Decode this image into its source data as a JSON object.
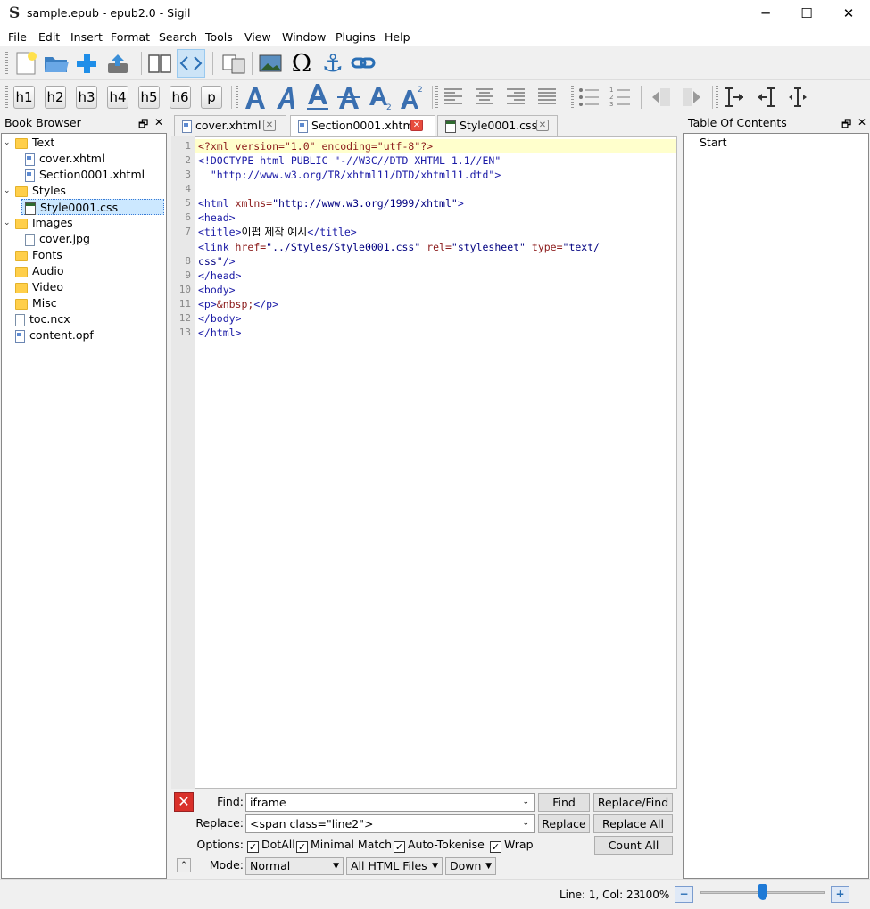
{
  "window": {
    "title": "sample.epub - epub2.0 - Sigil",
    "app_icon": "S",
    "minimize": "─",
    "maximize": "☐",
    "close": "✕"
  },
  "menu": [
    "File",
    "Edit",
    "Insert",
    "Format",
    "Search",
    "Tools",
    "View",
    "Window",
    "Plugins",
    "Help"
  ],
  "toolbar": {
    "headings": [
      "h1",
      "h2",
      "h3",
      "h4",
      "h5",
      "h6",
      "p"
    ],
    "omega": "Ω",
    "anchor": "⚓"
  },
  "book_browser": {
    "title": "Book Browser",
    "float": "🗗",
    "close": "✕",
    "items": [
      {
        "label": "Text",
        "type": "folder",
        "depth": 0,
        "expanded": true
      },
      {
        "label": "cover.xhtml",
        "type": "xhtml",
        "depth": 1
      },
      {
        "label": "Section0001.xhtml",
        "type": "xhtml",
        "depth": 1
      },
      {
        "label": "Styles",
        "type": "folder",
        "depth": 0,
        "expanded": true
      },
      {
        "label": "Style0001.css",
        "type": "css",
        "depth": 1,
        "selected": true
      },
      {
        "label": "Images",
        "type": "folder",
        "depth": 0,
        "expanded": true
      },
      {
        "label": "cover.jpg",
        "type": "file",
        "depth": 1
      },
      {
        "label": "Fonts",
        "type": "folder",
        "depth": 0
      },
      {
        "label": "Audio",
        "type": "folder",
        "depth": 0
      },
      {
        "label": "Video",
        "type": "folder",
        "depth": 0
      },
      {
        "label": "Misc",
        "type": "folder",
        "depth": 0
      },
      {
        "label": "toc.ncx",
        "type": "file",
        "depth": 0
      },
      {
        "label": "content.opf",
        "type": "xhtml",
        "depth": 0
      }
    ]
  },
  "tabs": [
    {
      "label": "cover.xhtml",
      "active": false
    },
    {
      "label": "Section0001.xhtml",
      "active": true
    },
    {
      "label": "Style0001.css",
      "active": false
    }
  ],
  "code_lines": [
    "1",
    "2",
    "3",
    "4",
    "5",
    "6",
    "7",
    "",
    "8",
    "9",
    "10",
    "11",
    "12",
    "13"
  ],
  "code": {
    "l1a": "<?xml version=\"1.0\" encoding=\"utf-8\"?>",
    "l2": "<!DOCTYPE html PUBLIC \"-//W3C//DTD XHTML 1.1//EN\"",
    "l3": "  \"http://www.w3.org/TR/xhtml11/DTD/xhtml11.dtd\">",
    "l5a": "<html ",
    "l5b": "xmlns=",
    "l5c": "\"http://www.w3.org/1999/xhtml\"",
    "l5d": ">",
    "l6": "<head>",
    "l7a": "<title>",
    "l7b": "이펍 제작 예시",
    "l7c": "</title>",
    "l8a": "<link ",
    "l8b": "href=",
    "l8c": "\"../Styles/Style0001.css\"",
    "l8d": " rel=",
    "l8e": "\"stylesheet\"",
    "l8f": " type=",
    "l8g": "\"text/",
    "l8h": "css\"",
    "l8i": "/>",
    "l9": "</head>",
    "l10": "<body>",
    "l11a": "<p>",
    "l11b": "&nbsp;",
    "l11c": "</p>",
    "l12": "</body>",
    "l13": "</html>"
  },
  "find_replace": {
    "find_label": "Find:",
    "find_value": "iframe",
    "replace_label": "Replace:",
    "replace_value": "<span class=\"line2\">",
    "options_label": "Options:",
    "mode_label": "Mode:",
    "buttons": {
      "find": "Find",
      "replace_find": "Replace/Find",
      "replace": "Replace",
      "replace_all": "Replace All",
      "count_all": "Count All"
    },
    "options": [
      {
        "label": "DotAll",
        "checked": true
      },
      {
        "label": "Minimal Match",
        "checked": true
      },
      {
        "label": "Auto-Tokenise",
        "checked": true
      },
      {
        "label": "Wrap",
        "checked": true
      }
    ],
    "mode": "Normal",
    "scope": "All HTML Files",
    "direction": "Down"
  },
  "toc": {
    "title": "Table Of Contents",
    "float": "🗗",
    "close": "✕",
    "items": [
      "Start"
    ]
  },
  "status": {
    "position": "Line: 1, Col: 23",
    "zoom": "100%",
    "zoom_fraction": 0.5
  },
  "colors": {
    "selection": "#cce8ff",
    "current_line": "#ffffcc",
    "close_red": "#e84c3d"
  }
}
